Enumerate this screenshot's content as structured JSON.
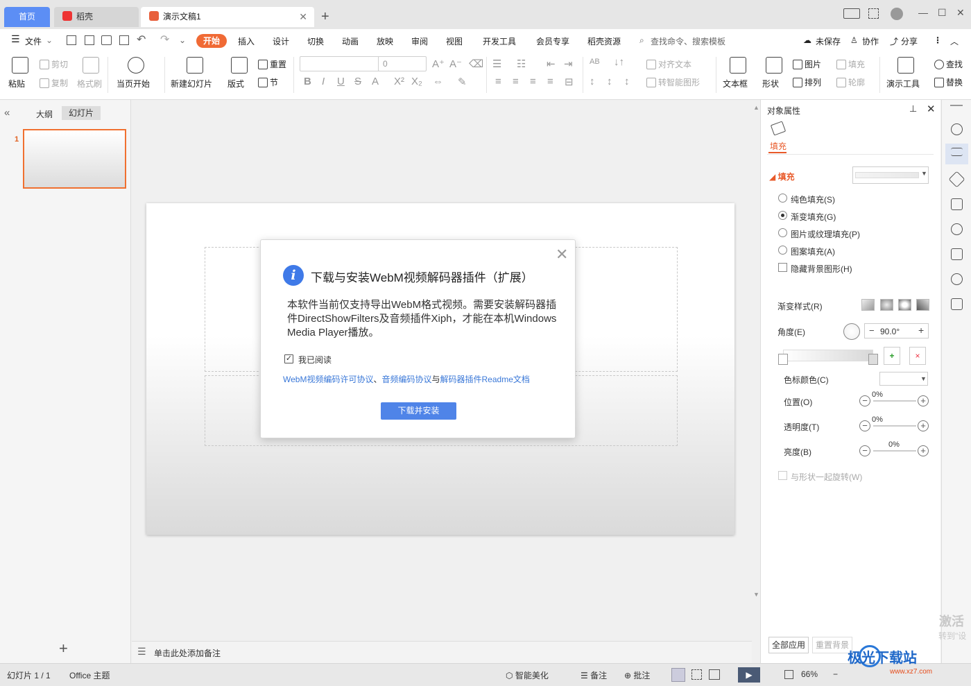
{
  "tabs": {
    "home": "首页",
    "daoke": "稻壳",
    "doc": "演示文稿1",
    "add": "+"
  },
  "window": {
    "minimize": "—",
    "maximize": "☐",
    "close": "✕"
  },
  "menu": {
    "file": "文件",
    "items": [
      "开始",
      "插入",
      "设计",
      "切换",
      "动画",
      "放映",
      "审阅",
      "视图",
      "开发工具",
      "会员专享",
      "稻壳资源"
    ],
    "search": "查找命令、搜索模板",
    "unsaved": "未保存",
    "collab": "协作",
    "share": "分享"
  },
  "ribbon": {
    "paste": "粘贴",
    "cut": "剪切",
    "copy": "复制",
    "format_painter": "格式刷",
    "from_current": "当页开始",
    "new_slide": "新建幻灯片",
    "layout": "版式",
    "reset": "重置",
    "section": "节",
    "font_size": "0",
    "align_text": "对齐文本",
    "smart_shape": "转智能图形",
    "textbox": "文本框",
    "shape": "形状",
    "picture": "图片",
    "arrange": "排列",
    "fill": "填充",
    "outline": "轮廓",
    "present_tools": "演示工具",
    "find": "查找",
    "replace": "替换"
  },
  "left_panel": {
    "outline_tab": "大纲",
    "slides_tab": "幻灯片",
    "slide_number": "1"
  },
  "notes": {
    "placeholder": "单击此处添加备注"
  },
  "dialog": {
    "title": "下载与安装WebM视频解码器插件（扩展）",
    "body": "本软件当前仅支持导出WebM格式视频。需要安装解码器插件DirectShowFilters及音频插件Xiph，才能在本机Windows Media Player播放。",
    "checkbox_label": "我已阅读",
    "link1": "WebM视频编码许可协议",
    "sep1": "、",
    "link2": "音频编码协议",
    "sep2": "与",
    "link3": "解码器插件Readme文档",
    "button": "下载并安装"
  },
  "properties": {
    "header": "对象属性",
    "fill_tab": "填充",
    "fill_section": "填充",
    "solid": "纯色填充(S)",
    "gradient": "渐变填充(G)",
    "picture_texture": "图片或纹理填充(P)",
    "pattern": "图案填充(A)",
    "hide_bg": "隐藏背景图形(H)",
    "gradient_style": "渐变样式(R)",
    "angle": "角度(E)",
    "angle_value": "90.0°",
    "stop_color": "色标颜色(C)",
    "position": "位置(O)",
    "position_value": "0%",
    "transparency": "透明度(T)",
    "transparency_value": "0%",
    "brightness": "亮度(B)",
    "brightness_value": "0%",
    "rotate_with_shape": "与形状一起旋转(W)",
    "apply_all": "全部应用",
    "reset_bg": "重置背景"
  },
  "status": {
    "slide_count": "幻灯片 1 / 1",
    "theme": "Office 主题",
    "smart_beautify": "智能美化",
    "notes": "备注",
    "comments": "批注",
    "zoom": "66%"
  },
  "activation": {
    "line1": "激活",
    "line2": "转到\"设"
  },
  "watermark": {
    "text": "极光下载站",
    "url": "www.xz7.com"
  },
  "colors": {
    "accent": "#f06a35",
    "primary": "#4f84e8",
    "link": "#3a78d8"
  }
}
